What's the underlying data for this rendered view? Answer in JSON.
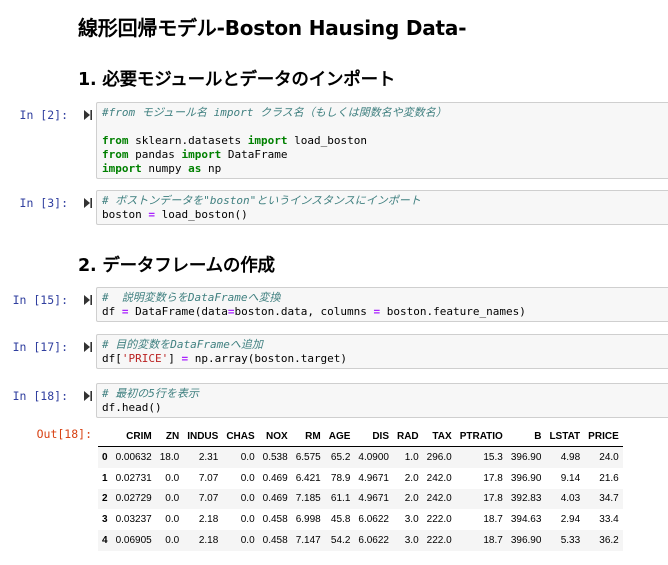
{
  "title": "線形回帰モデル-Boston Hausing Data-",
  "sections": {
    "s1": "1. 必要モジュールとデータのインポート",
    "s2": "2. データフレームの作成"
  },
  "cells": {
    "c2": {
      "prompt": "In [2]:",
      "comment": "#from モジュール名 import クラス名（もしくは関数名や変数名）",
      "l1": {
        "k1": "from",
        "t1": " sklearn.datasets ",
        "k2": "import",
        "t2": " load_boston"
      },
      "l2": {
        "k1": "from",
        "t1": " pandas ",
        "k2": "import",
        "t2": " DataFrame"
      },
      "l3": {
        "k1": "import",
        "t1": " numpy ",
        "k2": "as",
        "t2": " np"
      }
    },
    "c3": {
      "prompt": "In [3]:",
      "comment": "# ボストンデータを\"boston\"というインスタンスにインポート",
      "l1": {
        "a": "boston ",
        "op": "=",
        "b": " load_boston()"
      }
    },
    "c15": {
      "prompt": "In [15]:",
      "comment": "#  説明変数らをDataFrameへ変換",
      "l1": {
        "a": "df ",
        "op1": "=",
        "b": " DataFrame(data",
        "op2": "=",
        "c": "boston.data, columns ",
        "op3": "=",
        "d": " boston.feature_names)"
      }
    },
    "c17": {
      "prompt": "In [17]:",
      "comment": "# 目的変数をDataFrameへ追加",
      "l1": {
        "a": "df[",
        "s": "'PRICE'",
        "b": "] ",
        "op": "=",
        "c": " np.array(boston.target)"
      }
    },
    "c18": {
      "prompt": "In [18]:",
      "comment": "# 最初の5行を表示",
      "l1": "df.head()",
      "out_prompt": "Out[18]:"
    }
  },
  "table": {
    "columns": [
      "CRIM",
      "ZN",
      "INDUS",
      "CHAS",
      "NOX",
      "RM",
      "AGE",
      "DIS",
      "RAD",
      "TAX",
      "PTRATIO",
      "B",
      "LSTAT",
      "PRICE"
    ],
    "rows": [
      {
        "index": "0",
        "cells": [
          "0.00632",
          "18.0",
          "2.31",
          "0.0",
          "0.538",
          "6.575",
          "65.2",
          "4.0900",
          "1.0",
          "296.0",
          "15.3",
          "396.90",
          "4.98",
          "24.0"
        ]
      },
      {
        "index": "1",
        "cells": [
          "0.02731",
          "0.0",
          "7.07",
          "0.0",
          "0.469",
          "6.421",
          "78.9",
          "4.9671",
          "2.0",
          "242.0",
          "17.8",
          "396.90",
          "9.14",
          "21.6"
        ]
      },
      {
        "index": "2",
        "cells": [
          "0.02729",
          "0.0",
          "7.07",
          "0.0",
          "0.469",
          "7.185",
          "61.1",
          "4.9671",
          "2.0",
          "242.0",
          "17.8",
          "392.83",
          "4.03",
          "34.7"
        ]
      },
      {
        "index": "3",
        "cells": [
          "0.03237",
          "0.0",
          "2.18",
          "0.0",
          "0.458",
          "6.998",
          "45.8",
          "6.0622",
          "3.0",
          "222.0",
          "18.7",
          "394.63",
          "2.94",
          "33.4"
        ]
      },
      {
        "index": "4",
        "cells": [
          "0.06905",
          "0.0",
          "2.18",
          "0.0",
          "0.458",
          "7.147",
          "54.2",
          "6.0622",
          "3.0",
          "222.0",
          "18.7",
          "396.90",
          "5.33",
          "36.2"
        ]
      }
    ]
  }
}
